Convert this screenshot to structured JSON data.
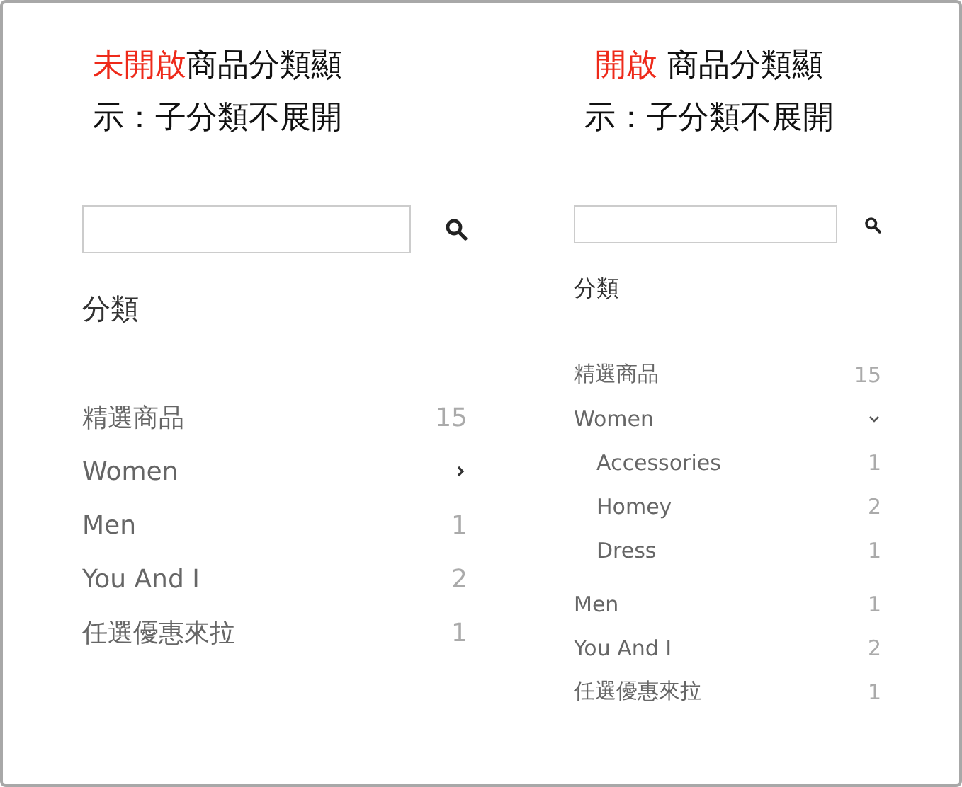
{
  "panels": [
    {
      "heading": {
        "highlight": "未開啟",
        "text": "商品分類顯示：子分類不展開"
      },
      "section_title": "分類",
      "categories": [
        {
          "name": "精選商品",
          "count": "15"
        },
        {
          "name": "Women",
          "expanded": false
        },
        {
          "name": "Men",
          "count": "1"
        },
        {
          "name": "You And I",
          "count": "2"
        },
        {
          "name": "任選優惠來拉",
          "count": "1"
        }
      ]
    },
    {
      "heading": {
        "highlight": "開啟",
        "text": " 商品分類顯示：子分類不展開"
      },
      "section_title": "分類",
      "categories": [
        {
          "name": "精選商品",
          "count": "15"
        },
        {
          "name": "Women",
          "expanded": true,
          "children": [
            {
              "name": "Accessories",
              "count": "1"
            },
            {
              "name": "Homey",
              "count": "2"
            },
            {
              "name": "Dress",
              "count": "1"
            }
          ]
        },
        {
          "name": "Men",
          "count": "1"
        },
        {
          "name": "You And I",
          "count": "2"
        },
        {
          "name": "任選優惠來拉",
          "count": "1"
        }
      ]
    }
  ]
}
